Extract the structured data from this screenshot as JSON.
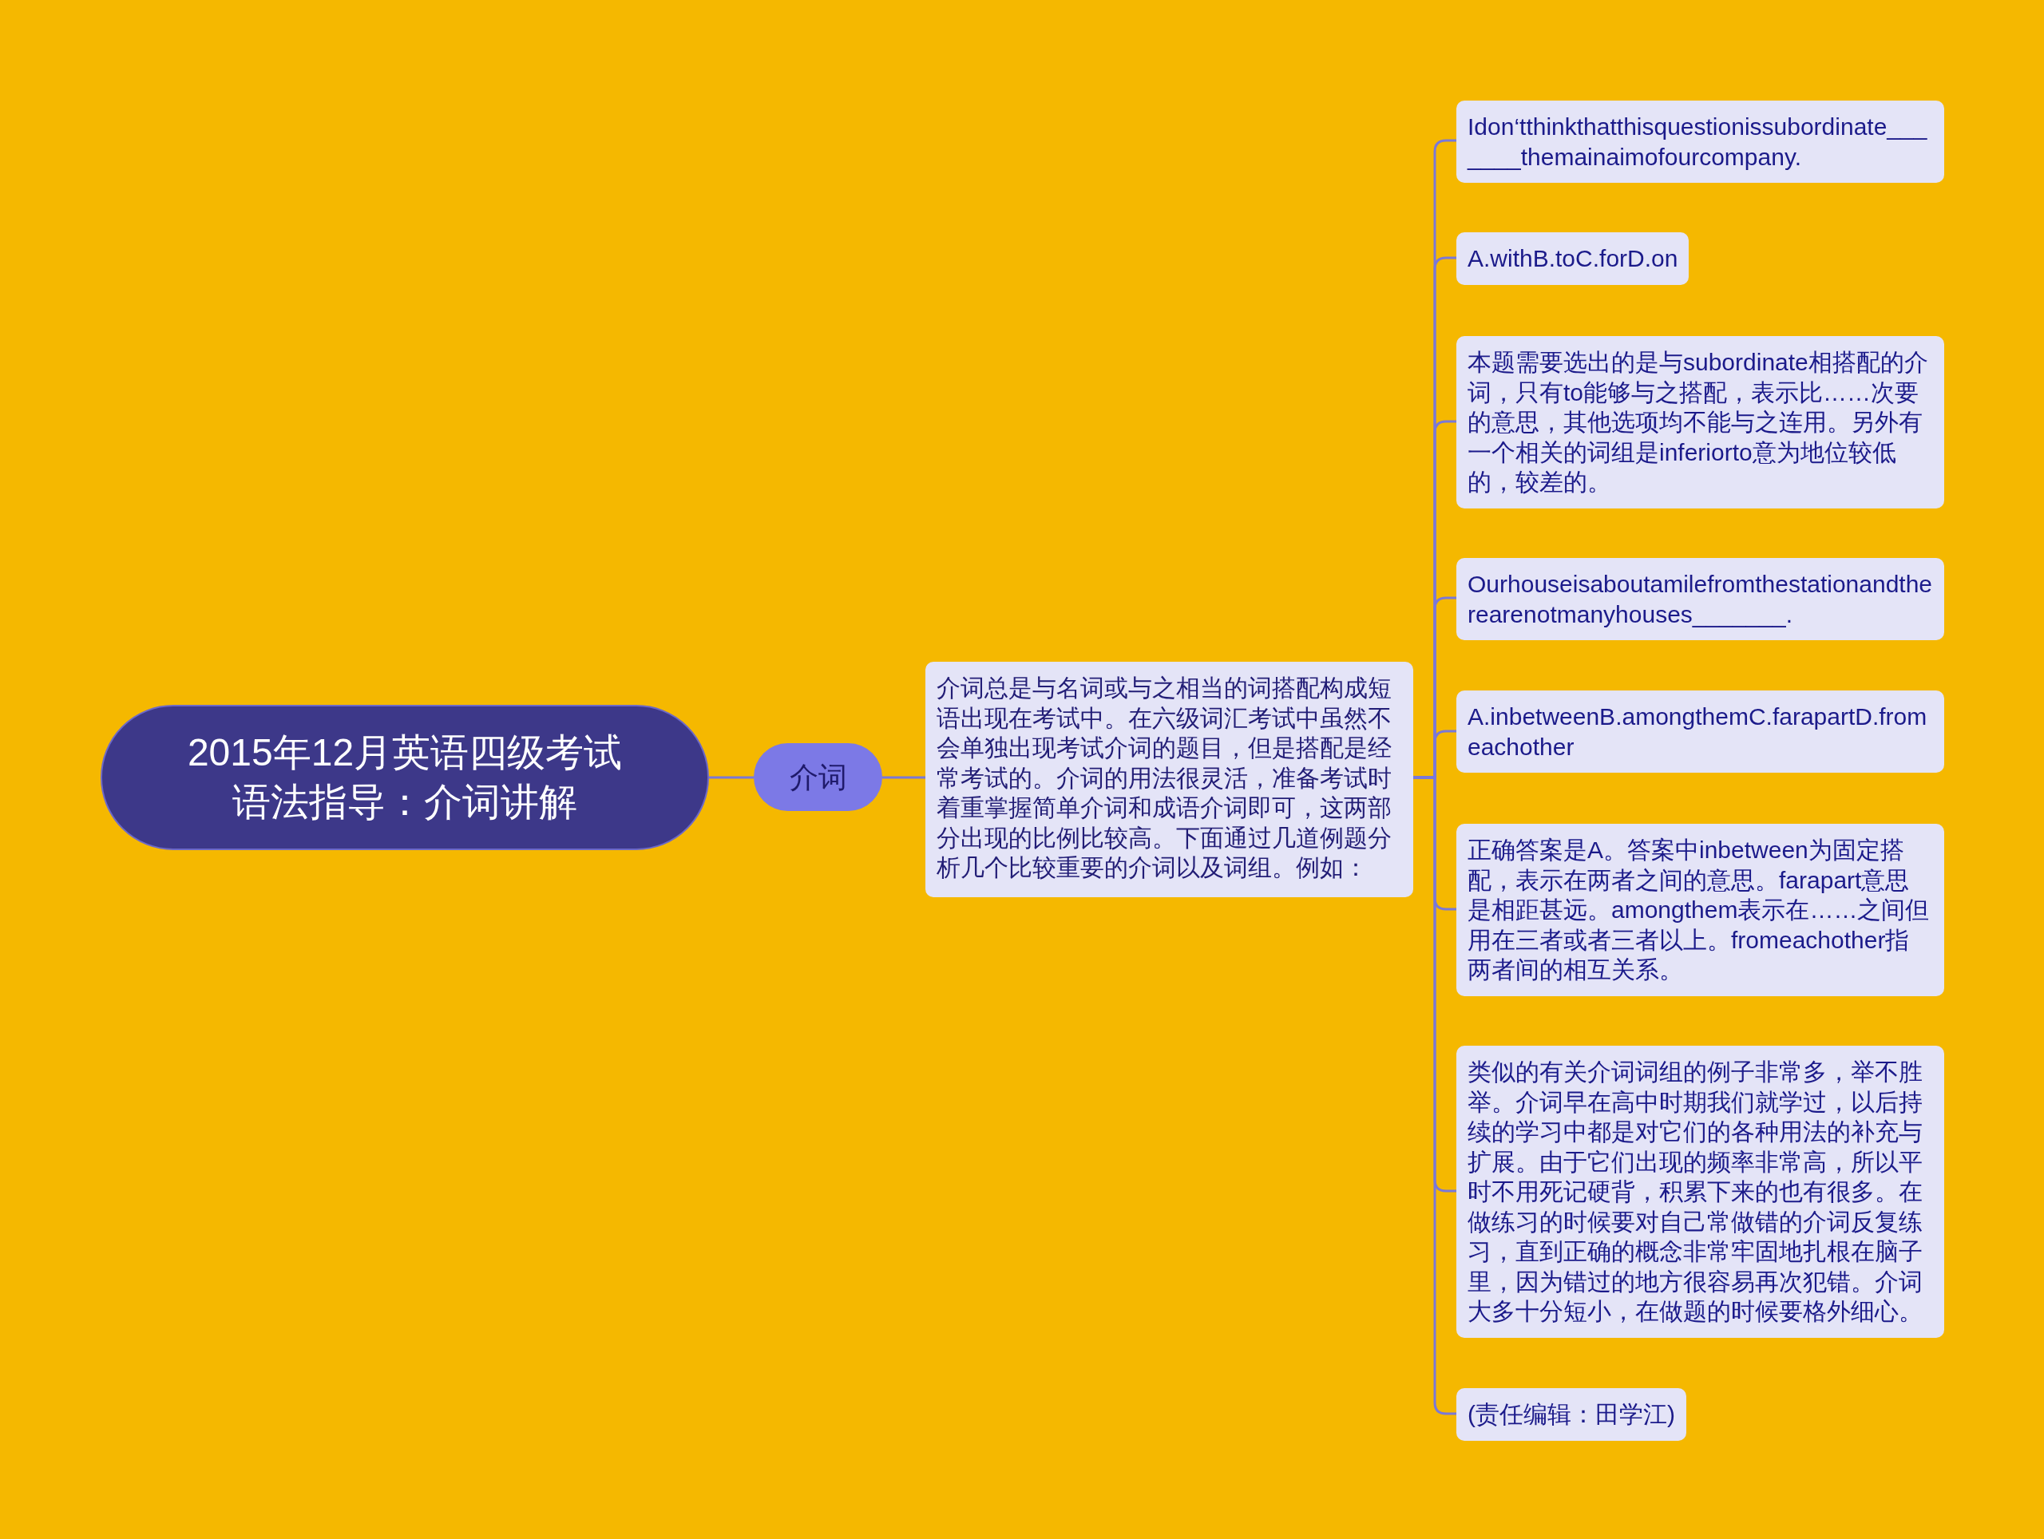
{
  "root": {
    "title_lines": [
      "2015年12月英语四级考试",
      "语法指导：介词讲解"
    ]
  },
  "branch": {
    "label": "介词"
  },
  "intro": {
    "text": "介词总是与名词或与之相当的词搭配构成短语出现在考试中。在六级词汇考试中虽然不会单独出现考试介词的题目，但是搭配是经常考试的。介词的用法很灵活，准备考试时着重掌握简单介词和成语介词即可，这两部分出现的比例比较高。下面通过几道例题分析几个比较重要的介词以及词组。例如："
  },
  "notes": [
    {
      "text": "Idon‘tthinkthatthisquestionissubordinate_______themainaimofourcompany."
    },
    {
      "text": "A.withB.toC.forD.on"
    },
    {
      "text": "本题需要选出的是与subordinate相搭配的介词，只有to能够与之搭配，表示比……次要的意思，其他选项均不能与之连用。另外有一个相关的词组是inferiorto意为地位较低的，较差的。"
    },
    {
      "text": "Ourhouseisaboutamilefromthestationandtherearenotmanyhouses_______."
    },
    {
      "text": "A.inbetweenB.amongthemC.farapartD.fromeachother"
    },
    {
      "text": "正确答案是A。答案中inbetween为固定搭配，表示在两者之间的意思。farapart意思是相距甚远。amongthem表示在……之间但用在三者或者三者以上。fromeachother指两者间的相互关系。"
    },
    {
      "text": "类似的有关介词词组的例子非常多，举不胜举。介词早在高中时期我们就学过，以后持续的学习中都是对它们的各种用法的补充与扩展。由于它们出现的频率非常高，所以平时不用死记硬背，积累下来的也有很多。在做练习的时候要对自己常做错的介词反复练习，直到正确的概念非常牢固地扎根在脑子里，因为错过的地方很容易再次犯错。介词大多十分短小，在做题的时候要格外细心。"
    },
    {
      "text": "(责任编辑：田学江)"
    }
  ]
}
